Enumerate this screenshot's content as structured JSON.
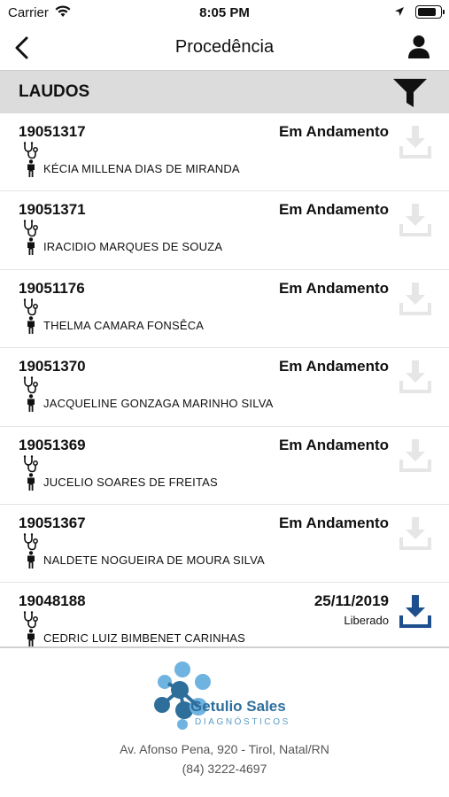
{
  "status_bar": {
    "carrier": "Carrier",
    "time": "8:05 PM",
    "battery_level": 0.85
  },
  "nav": {
    "title": "Procedência"
  },
  "section": {
    "title": "LAUDOS"
  },
  "items": [
    {
      "code": "19051317",
      "status": "Em Andamento",
      "sub": "",
      "name": "KÉCIA MILLENA DIAS DE MIRANDA",
      "download_enabled": false
    },
    {
      "code": "19051371",
      "status": "Em Andamento",
      "sub": "",
      "name": "IRACIDIO MARQUES DE SOUZA",
      "download_enabled": false
    },
    {
      "code": "19051176",
      "status": "Em Andamento",
      "sub": "",
      "name": "THELMA CAMARA FONSÊCA",
      "download_enabled": false
    },
    {
      "code": "19051370",
      "status": "Em Andamento",
      "sub": "",
      "name": "JACQUELINE GONZAGA MARINHO SILVA",
      "download_enabled": false
    },
    {
      "code": "19051369",
      "status": "Em Andamento",
      "sub": "",
      "name": "JUCELIO SOARES DE FREITAS",
      "download_enabled": false
    },
    {
      "code": "19051367",
      "status": "Em Andamento",
      "sub": "",
      "name": "NALDETE NOGUEIRA DE MOURA SILVA",
      "download_enabled": false
    },
    {
      "code": "19048188",
      "status": "25/11/2019",
      "sub": "Liberado",
      "name": "CEDRIC LUIZ BIMBENET CARINHAS",
      "download_enabled": true
    }
  ],
  "footer": {
    "brand_name": "Getulio Sales",
    "brand_tagline": "DIAGNÓSTICOS",
    "address": "Av. Afonso Pena, 920 - Tirol, Natal/RN",
    "phone": "(84) 3222-4697"
  },
  "colors": {
    "download_active": "#1d4f8c",
    "download_disabled": "#e6e6e6",
    "header_bg": "#dcdcdc",
    "logo_light": "#6fb3e0",
    "logo_dark": "#2d6e9b"
  },
  "icons": {
    "back": "chevron-left-icon",
    "profile": "user-icon",
    "filter": "filter-icon",
    "doctor": "stethoscope-icon",
    "patient": "person-icon",
    "download": "download-icon"
  }
}
